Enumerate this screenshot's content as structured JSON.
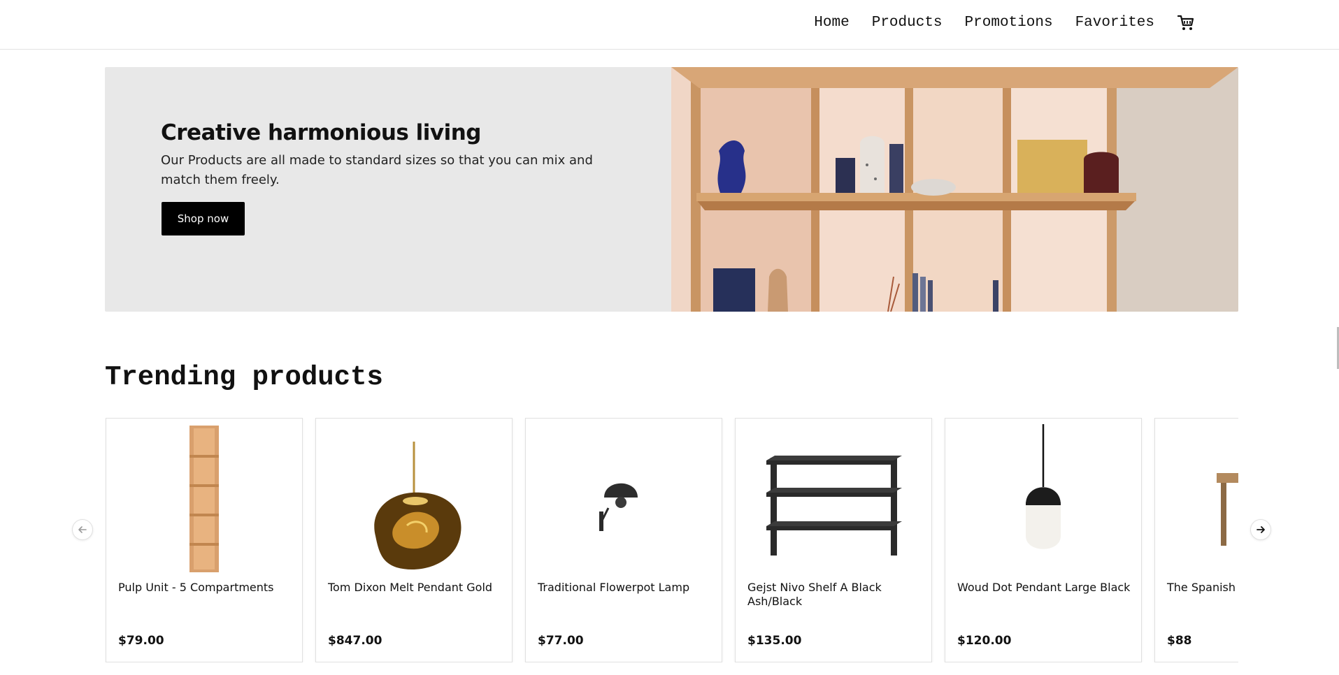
{
  "nav": {
    "items": [
      "Home",
      "Products",
      "Promotions",
      "Favorites"
    ],
    "cart_icon": "cart-icon"
  },
  "hero": {
    "title": "Creative harmonious living",
    "subtitle": "Our Products are all made to standard sizes so that you can mix and match them freely.",
    "button_label": "Shop now"
  },
  "trending": {
    "title": "Trending products",
    "products": [
      {
        "name": "Pulp Unit - 5 Compartments",
        "price": "$79.00"
      },
      {
        "name": "Tom Dixon Melt Pendant Gold",
        "price": "$847.00"
      },
      {
        "name": "Traditional Flowerpot Lamp",
        "price": "$77.00"
      },
      {
        "name": "Gejst Nivo Shelf A Black Ash/Black",
        "price": "$135.00"
      },
      {
        "name": "Woud Dot Pendant Large Black",
        "price": "$120.00"
      },
      {
        "name": "The Spanish Chair Oak/Natural",
        "price": "$88"
      }
    ],
    "prev_icon": "arrow-left-icon",
    "next_icon": "arrow-right-icon"
  },
  "colors": {
    "hero_bg": "#e8e8e8",
    "button_bg": "#000000",
    "text": "#111111"
  }
}
